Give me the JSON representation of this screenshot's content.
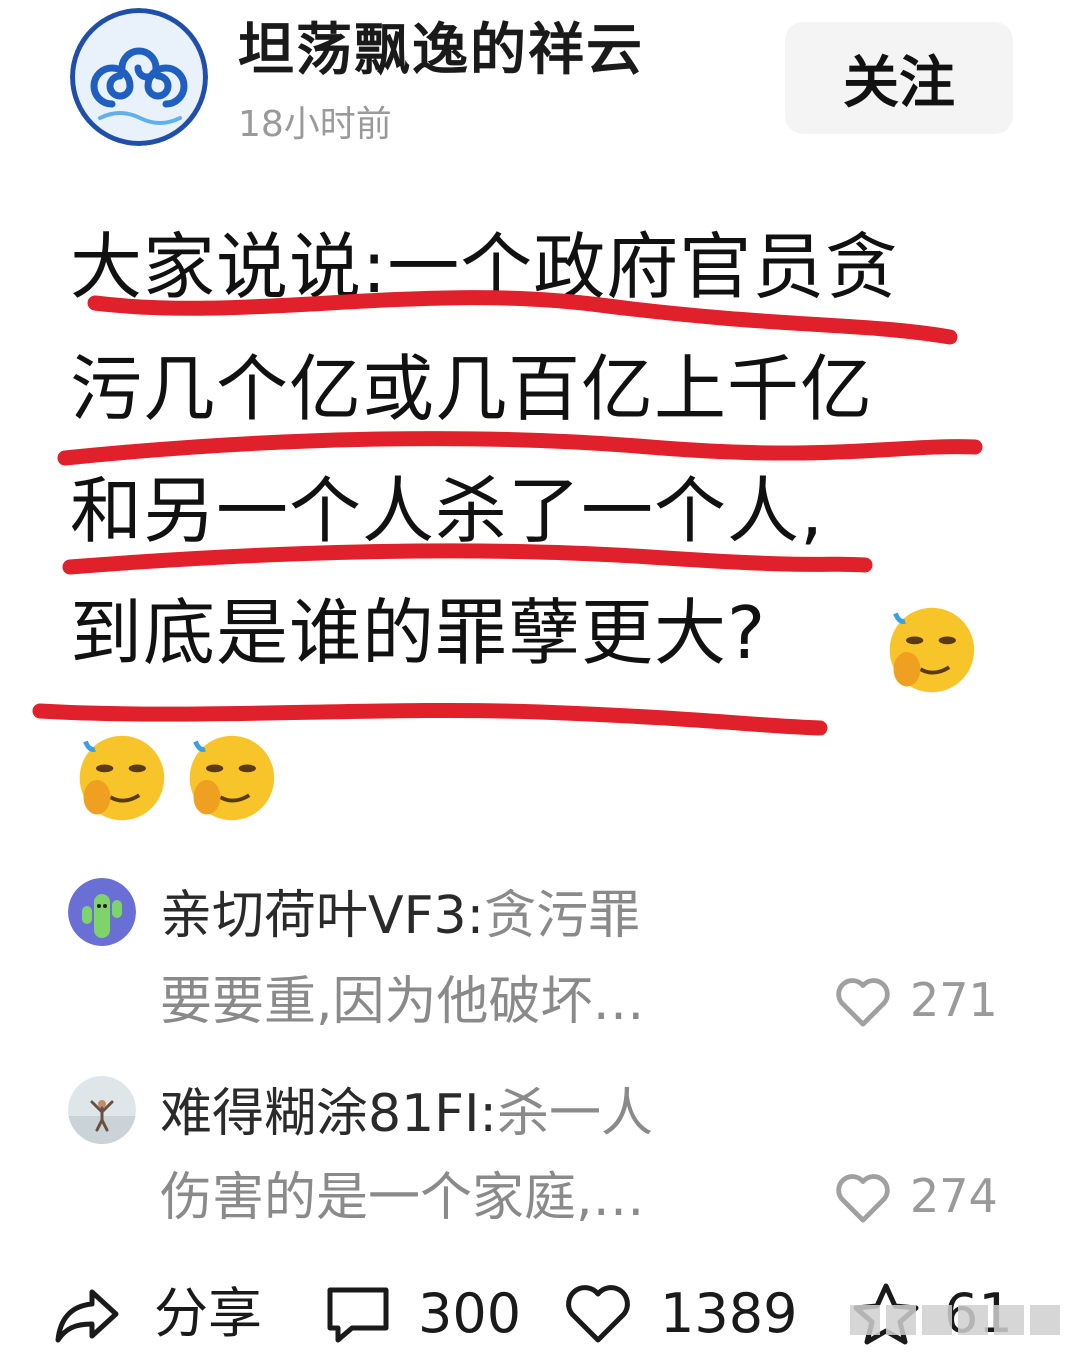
{
  "author": {
    "name": "坦荡飘逸的祥云",
    "time": "18小时前",
    "avatar_icon": "auspicious-cloud-avatar"
  },
  "follow_button": {
    "label": "关注"
  },
  "post": {
    "lines": [
      "大家说说:一个政府官员贪",
      "污几个亿或几百亿上千亿",
      "和另一个人杀了一个人,",
      "到底是谁的罪孽更大?"
    ],
    "emoji_icon": "thinking-smirk-emoji",
    "underline_color": "#e0202a"
  },
  "comments": [
    {
      "user": "亲切荷叶VF3",
      "separator": ":",
      "text_first": "贪污罪",
      "text_second": "要要重,因为他破坏…",
      "likes": "271",
      "avatar_icon": "cactus-avatar"
    },
    {
      "user": "难得糊涂81FI",
      "separator": ":",
      "text_first": "杀一人",
      "text_second": "伤害的是一个家庭,…",
      "likes": "274",
      "avatar_icon": "beach-photo-avatar"
    }
  ],
  "footer": {
    "share_label": "分享",
    "comment_count": "300",
    "like_count": "1389",
    "favorite_count": "61",
    "icons": [
      "share-arrow-icon",
      "comment-bubble-icon",
      "heart-icon",
      "star-icon"
    ]
  }
}
